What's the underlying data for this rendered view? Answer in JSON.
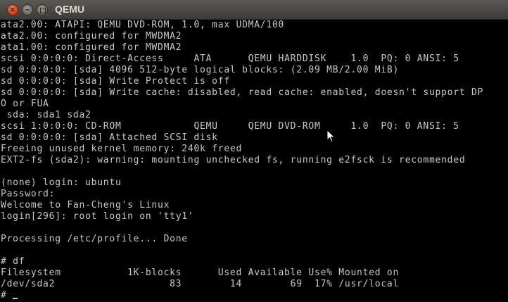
{
  "window": {
    "title": "QEMU",
    "close_glyph": "×",
    "minimize_glyph": "–"
  },
  "console": {
    "lines": [
      "ata2.00: ATAPI: QEMU DVD-ROM, 1.0, max UDMA/100",
      "ata2.00: configured for MWDMA2",
      "ata1.00: configured for MWDMA2",
      "scsi 0:0:0:0: Direct-Access     ATA      QEMU HARDDISK    1.0  PQ: 0 ANSI: 5",
      "sd 0:0:0:0: [sda] 4096 512-byte logical blocks: (2.09 MB/2.00 MiB)",
      "sd 0:0:0:0: [sda] Write Protect is off",
      "sd 0:0:0:0: [sda] Write cache: disabled, read cache: enabled, doesn't support DP",
      "O or FUA",
      " sda: sda1 sda2",
      "scsi 1:0:0:0: CD-ROM            QEMU     QEMU DVD-ROM     1.0  PQ: 0 ANSI: 5",
      "sd 0:0:0:0: [sda] Attached SCSI disk",
      "Freeing unused kernel memory: 240k freed",
      "EXT2-fs (sda2): warning: mounting unchecked fs, running e2fsck is recommended",
      "",
      "(none) login: ubuntu",
      "Password:",
      "Welcome to Fan-Cheng's Linux",
      "login[296]: root login on 'tty1'",
      "",
      "Processing /etc/profile... Done",
      "",
      "# df",
      "Filesystem           1K-blocks      Used Available Use% Mounted on",
      "/dev/sda2                   83        14        69  17% /usr/local"
    ],
    "prompt": "#"
  }
}
